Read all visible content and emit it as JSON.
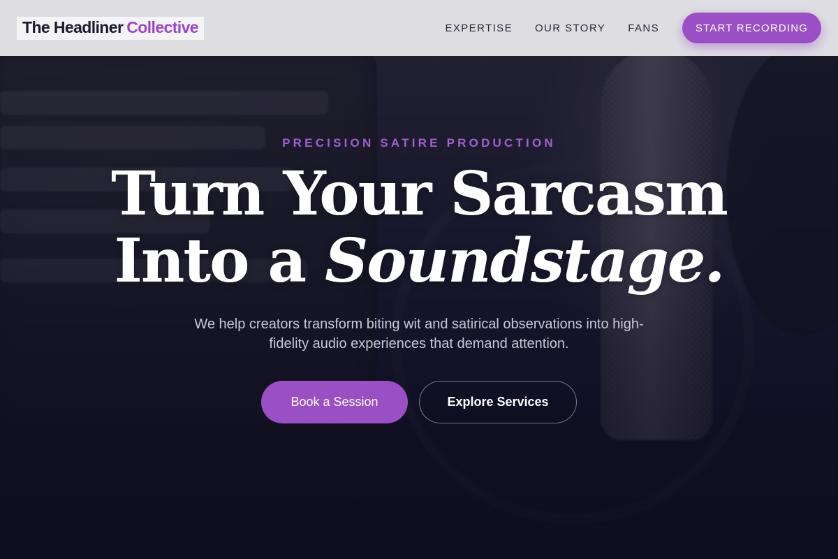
{
  "header": {
    "logo_part1": "The Headliner",
    "logo_part2": "Collective",
    "nav": [
      "EXPERTISE",
      "OUR STORY",
      "FANS"
    ],
    "cta_label": "START RECORDING"
  },
  "hero": {
    "eyebrow": "PRECISION SATIRE PRODUCTION",
    "headline_line1": "Turn Your Sarcasm",
    "headline_line2_plain": "Into a",
    "headline_line2_italic": "Soundstage.",
    "subtext": "We help creators transform biting wit and satirical observations into high-fidelity audio experiences that demand attention.",
    "primary_button": "Book a Session",
    "secondary_button": "Explore Services"
  },
  "colors": {
    "accent": "#9a4fc4",
    "eyebrow": "#a45fd0",
    "header_bg": "#e4e4e8",
    "dark_text": "#1c1b2e"
  }
}
